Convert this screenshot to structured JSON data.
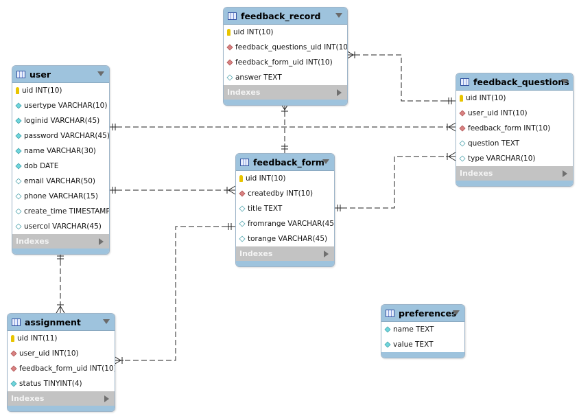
{
  "diagram": {
    "colors": {
      "header": "#9ec3dd",
      "indexes": "#c3c3c3",
      "primary_key": "#e8c400",
      "not_null": "#6fd6dc",
      "foreign_key": "#d88282"
    },
    "indexes_label": "Indexes",
    "tables": [
      {
        "id": "feedback_record",
        "name": "feedback_record",
        "has_indexes": true,
        "columns": [
          {
            "icon": "key",
            "text": "uid INT(10)"
          },
          {
            "icon": "fk",
            "text": "feedback_questions_uid INT(10)"
          },
          {
            "icon": "fk",
            "text": "feedback_form_uid INT(10)"
          },
          {
            "icon": "nul",
            "text": "answer TEXT"
          }
        ]
      },
      {
        "id": "user",
        "name": "user",
        "has_indexes": true,
        "columns": [
          {
            "icon": "key",
            "text": "uid INT(10)"
          },
          {
            "icon": "nn",
            "text": "usertype VARCHAR(10)"
          },
          {
            "icon": "nn",
            "text": "loginid VARCHAR(45)"
          },
          {
            "icon": "nn",
            "text": "password VARCHAR(45)"
          },
          {
            "icon": "nn",
            "text": "name VARCHAR(30)"
          },
          {
            "icon": "nn",
            "text": "dob DATE"
          },
          {
            "icon": "nul",
            "text": "email VARCHAR(50)"
          },
          {
            "icon": "nul",
            "text": "phone VARCHAR(15)"
          },
          {
            "icon": "nul",
            "text": "create_time TIMESTAMP"
          },
          {
            "icon": "nul",
            "text": "usercol VARCHAR(45)"
          }
        ]
      },
      {
        "id": "feedback_questions",
        "name": "feedback_questions",
        "has_indexes": true,
        "columns": [
          {
            "icon": "key",
            "text": "uid INT(10)"
          },
          {
            "icon": "fk",
            "text": "user_uid INT(10)"
          },
          {
            "icon": "fk",
            "text": "feedback_form INT(10)"
          },
          {
            "icon": "nul",
            "text": "question TEXT"
          },
          {
            "icon": "nul",
            "text": "type VARCHAR(10)"
          }
        ]
      },
      {
        "id": "feedback_form",
        "name": "feedback_form",
        "has_indexes": true,
        "columns": [
          {
            "icon": "key",
            "text": "uid INT(10)"
          },
          {
            "icon": "fk",
            "text": "createdby INT(10)"
          },
          {
            "icon": "nul",
            "text": "title TEXT"
          },
          {
            "icon": "nul",
            "text": "fromrange VARCHAR(45)"
          },
          {
            "icon": "nul",
            "text": "torange VARCHAR(45)"
          }
        ]
      },
      {
        "id": "assignment",
        "name": "assignment",
        "has_indexes": true,
        "columns": [
          {
            "icon": "key",
            "text": "uid INT(11)"
          },
          {
            "icon": "fk",
            "text": "user_uid INT(10)"
          },
          {
            "icon": "fk",
            "text": "feedback_form_uid INT(10)"
          },
          {
            "icon": "nn",
            "text": "status TINYINT(4)"
          }
        ]
      },
      {
        "id": "preferences",
        "name": "preferences",
        "has_indexes": false,
        "columns": [
          {
            "icon": "nn",
            "text": "name TEXT"
          },
          {
            "icon": "nn",
            "text": "value TEXT"
          }
        ]
      }
    ],
    "relationships": [
      {
        "from": "feedback_record",
        "to": "feedback_questions",
        "from_end": "many",
        "to_end": "one"
      },
      {
        "from": "feedback_record",
        "to": "feedback_form",
        "from_end": "many",
        "to_end": "one"
      },
      {
        "from": "user",
        "to": "feedback_questions",
        "from_end": "one",
        "to_end": "many"
      },
      {
        "from": "user",
        "to": "feedback_form",
        "from_end": "one",
        "to_end": "many"
      },
      {
        "from": "feedback_form",
        "to": "feedback_questions",
        "from_end": "one",
        "to_end": "many"
      },
      {
        "from": "feedback_form",
        "to": "assignment",
        "from_end": "one",
        "to_end": "many"
      },
      {
        "from": "user",
        "to": "assignment",
        "from_end": "one",
        "to_end": "many"
      }
    ]
  }
}
